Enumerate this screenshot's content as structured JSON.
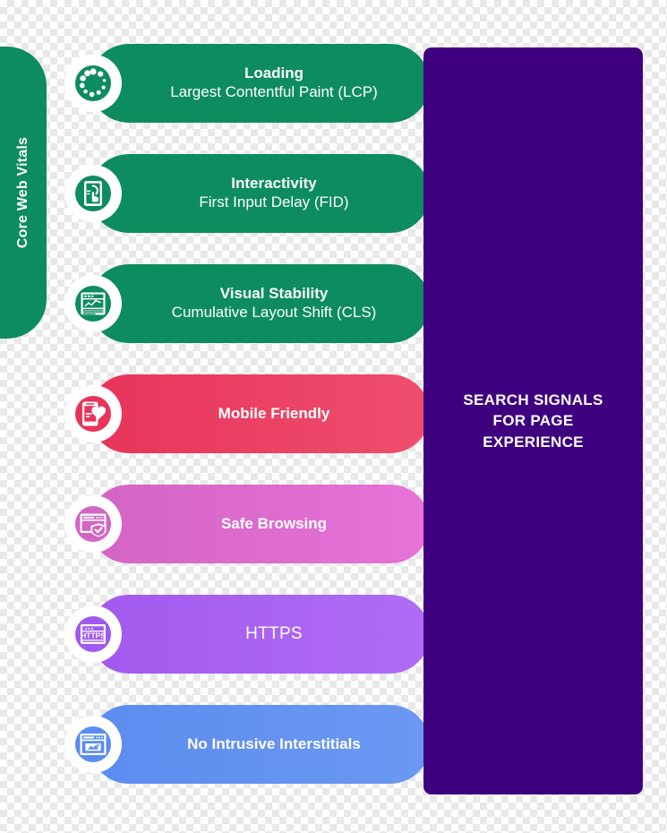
{
  "band": {
    "label": "Core Web Vitals",
    "color": "#0d8c5f"
  },
  "panel": {
    "text": "SEARCH SIGNALS FOR PAGE EXPERIENCE",
    "line1": "SEARCH SIGNALS",
    "line2": "FOR PAGE",
    "line3": "EXPERIENCE",
    "color": "#3f0080"
  },
  "arrow_color": "#2b2b2b",
  "rows": [
    {
      "id": "loading",
      "title": "Loading",
      "subtitle": "Largest Contentful Paint (LCP)",
      "icon": "spinner-icon",
      "color": "#0d8c5f",
      "color_end": "#0d8c5f"
    },
    {
      "id": "interactivity",
      "title": "Interactivity",
      "subtitle": "First Input Delay (FID)",
      "icon": "tap-hand-icon",
      "color": "#0d8c5f",
      "color_end": "#0d8c5f"
    },
    {
      "id": "visual-stability",
      "title": "Visual Stability",
      "subtitle": "Cumulative Layout Shift (CLS)",
      "icon": "browser-chart-icon",
      "color": "#0d8c5f",
      "color_end": "#0d8c5f"
    },
    {
      "id": "mobile-friendly",
      "title": "Mobile Friendly",
      "subtitle": "",
      "icon": "phone-heart-icon",
      "color": "#e8345a",
      "color_end": "#ef4e6e"
    },
    {
      "id": "safe-browsing",
      "title": "Safe Browsing",
      "subtitle": "",
      "icon": "browser-shield-icon",
      "color": "#d364c4",
      "color_end": "#e773d8"
    },
    {
      "id": "https",
      "title": "HTTPS",
      "subtitle": "",
      "icon": "https-browser-icon",
      "color": "#a259ee",
      "color_end": "#b06cf5"
    },
    {
      "id": "no-intrusive-interstitials",
      "title": "No Intrusive Interstitials",
      "subtitle": "",
      "icon": "browser-popup-icon",
      "color": "#5b8def",
      "color_end": "#6b98f2"
    }
  ]
}
